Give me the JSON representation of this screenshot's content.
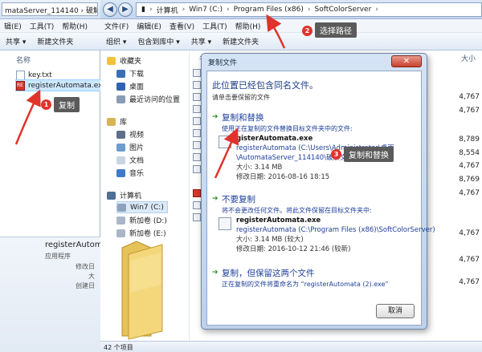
{
  "back_window": {
    "address": "mataServer_114140 › 破解文",
    "menu": [
      "辑(E)",
      "工具(T)",
      "帮助(H)"
    ],
    "toolbar": [
      "共享 ▾",
      "新建文件夹"
    ],
    "column_header": "名称",
    "files": [
      {
        "name": "key.txt",
        "icon": "text-file-icon"
      },
      {
        "name": "registerAutomata.exe",
        "icon": "exe-icon"
      }
    ],
    "details": {
      "name": "registerAutoma",
      "type": "应用程序",
      "labels": [
        "修改日",
        "大",
        "创建日"
      ]
    }
  },
  "front_window": {
    "breadcrumb": [
      "计算机",
      "Win7 (C:)",
      "Program Files (x86)",
      "SoftColorServer"
    ],
    "menu": [
      "文件(F)",
      "编辑(E)",
      "查看(V)",
      "工具(T)",
      "帮助(H)"
    ],
    "toolbar": [
      "组织 ▾",
      "包含到库中 ▾",
      "共享 ▾",
      "新建文件夹"
    ],
    "column_headers": [
      "名",
      "大小"
    ],
    "nav": {
      "favorites": {
        "label": "收藏夹",
        "items": [
          "下载",
          "桌面",
          "最近访问的位置"
        ]
      },
      "libraries": {
        "label": "库",
        "items": [
          "视频",
          "图片",
          "文档",
          "音乐"
        ]
      },
      "computer": {
        "label": "计算机",
        "items": [
          "Win7 (C:)",
          "新加卷 (D:)",
          "新加卷 (E:)"
        ]
      }
    },
    "sizes": [
      "4,767",
      "4,767",
      "8,789",
      "8,554",
      "4,767",
      "8,769",
      "4,767",
      "4,767",
      "4,767",
      "4,767"
    ],
    "status": "42 个项目"
  },
  "dialog": {
    "title": "复制文件",
    "close_label": "✕",
    "heading": "此位置已经包含同名文件。",
    "subheading": "请单击要保留的文件",
    "options": [
      {
        "title": "复制和替换",
        "desc": "使用正在复制的文件替换目标文件夹中的文件:",
        "file_name": "gisterAutomata.exe",
        "file_path": "registerAutomata (C:\\Users\\Administrator\\桌面",
        "file_path2": "\\AutomataServer_114140\\破解文",
        "size": "大小: 3.14 MB",
        "date": "修改日期: 2016-08-16 18:15"
      },
      {
        "title": "不要复制",
        "desc": "将不会更改任何文件。将此文件保留在目标文件夹中:",
        "file_name": "registerAutomata.exe",
        "file_path": "registerAutomata (C:\\Program Files (x86)\\SoftColorServer)",
        "size": "大小: 3.14 MB (较大)",
        "date": "修改日期: 2016-10-12 21:46 (较新)"
      },
      {
        "title": "复制，但保留这两个文件",
        "desc": "正在复制的文件将重命名为 “registerAutomata (2).exe”"
      }
    ],
    "cancel_label": "取消"
  },
  "annotations": {
    "step1": {
      "num": "1",
      "label": "复制"
    },
    "step2": {
      "num": "2",
      "label": "选择路径"
    },
    "step3": {
      "num": "3",
      "label": "复制和替换"
    }
  },
  "colors": {
    "annotation_red": "#e0332b",
    "link_blue": "#1e3f9a",
    "dialog_frame": "#bcd1ea"
  }
}
